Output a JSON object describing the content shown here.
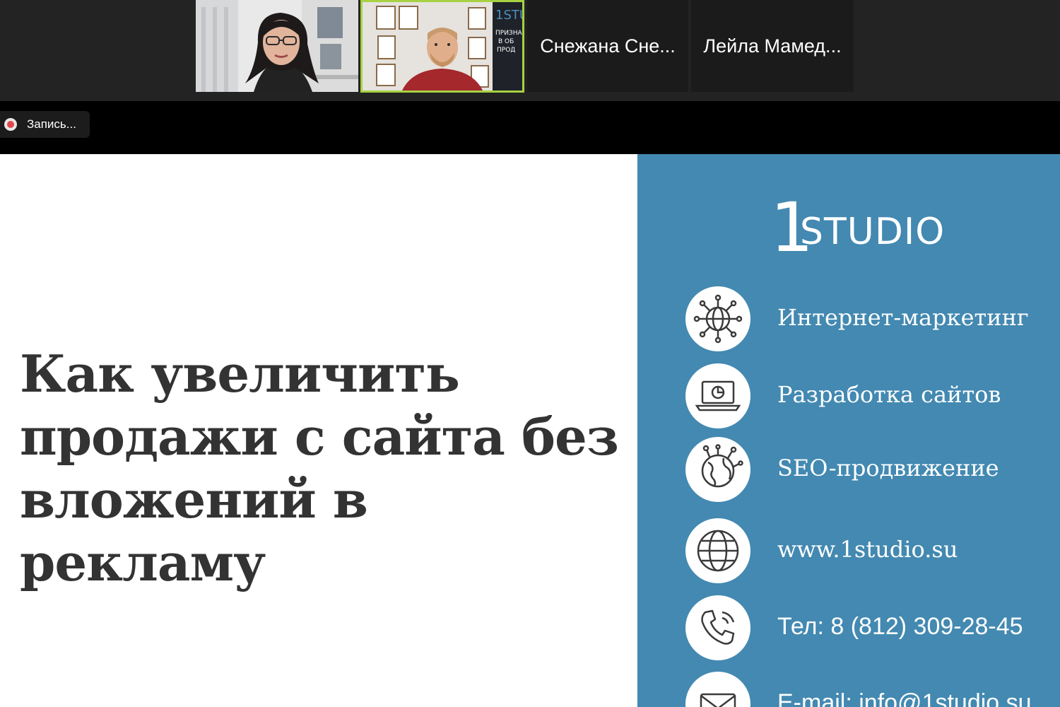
{
  "participants": [
    {
      "type": "video",
      "name": ""
    },
    {
      "type": "video",
      "name": "",
      "active_speaker": true
    },
    {
      "type": "name",
      "name": "Снежана Сне..."
    },
    {
      "type": "name",
      "name": "Лейла Мамед..."
    }
  ],
  "recording": {
    "label": "Запись..."
  },
  "slide": {
    "title": "Как увеличить продажи с сайта без вложений в рекламу",
    "logo": {
      "digit": "1",
      "word": "STUDIO"
    },
    "services": [
      {
        "icon": "network-globe-icon",
        "label": "Интернет-маркетинг"
      },
      {
        "icon": "laptop-chart-icon",
        "label": "Разработка сайтов"
      },
      {
        "icon": "earth-network-icon",
        "label": "SEO-продвижение"
      },
      {
        "icon": "globe-icon",
        "label": "www.1studio.su"
      },
      {
        "icon": "phone-icon",
        "label": "Тел: 8 (812) 309-28-45"
      },
      {
        "icon": "mail-icon",
        "label": "E-mail: info@1studio.su"
      }
    ]
  },
  "colors": {
    "panel": "#4389b1",
    "title_text": "#333333",
    "active_speaker_border": "#a7d142",
    "recording_dot": "#e0474c"
  }
}
